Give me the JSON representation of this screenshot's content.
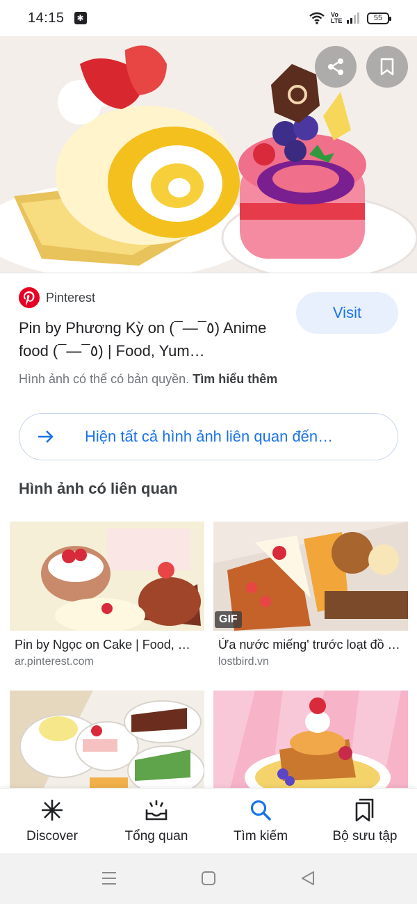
{
  "status_bar": {
    "time": "14:15",
    "volte": "Vo LTE",
    "battery": "55"
  },
  "result": {
    "source_name": "Pinterest",
    "title": "Pin by Phương Kỳ on (¯―¯٥) Anime food (¯―¯٥) | Food, Yum…",
    "visit_label": "Visit",
    "copyright_text": "Hình ảnh có thể có bản quyền.",
    "learn_more": "Tìm hiểu thêm",
    "show_all_label": "Hiện tất cả hình ảnh liên quan đến…"
  },
  "related": {
    "heading": "Hình ảnh có liên quan",
    "items": [
      {
        "title": "Pin by Ngọc on Cake | Food, …",
        "domain": "ar.pinterest.com",
        "badge": ""
      },
      {
        "title": "Ứa nước miếng' trước loạt đồ …",
        "domain": "lostbird.vn",
        "badge": "GIF"
      },
      {
        "title": "",
        "domain": "",
        "badge": ""
      },
      {
        "title": "",
        "domain": "",
        "badge": ""
      }
    ]
  },
  "bottom_nav": {
    "items": [
      {
        "label": "Discover",
        "icon": "asterisk-icon"
      },
      {
        "label": "Tổng quan",
        "icon": "inbox-crown-icon"
      },
      {
        "label": "Tìm kiếm",
        "icon": "search-icon"
      },
      {
        "label": "Bộ sưu tập",
        "icon": "collections-icon"
      }
    ]
  },
  "colors": {
    "accent": "#1a73e8",
    "visit_bg": "#e8f0fe",
    "pinterest": "#e60023"
  }
}
